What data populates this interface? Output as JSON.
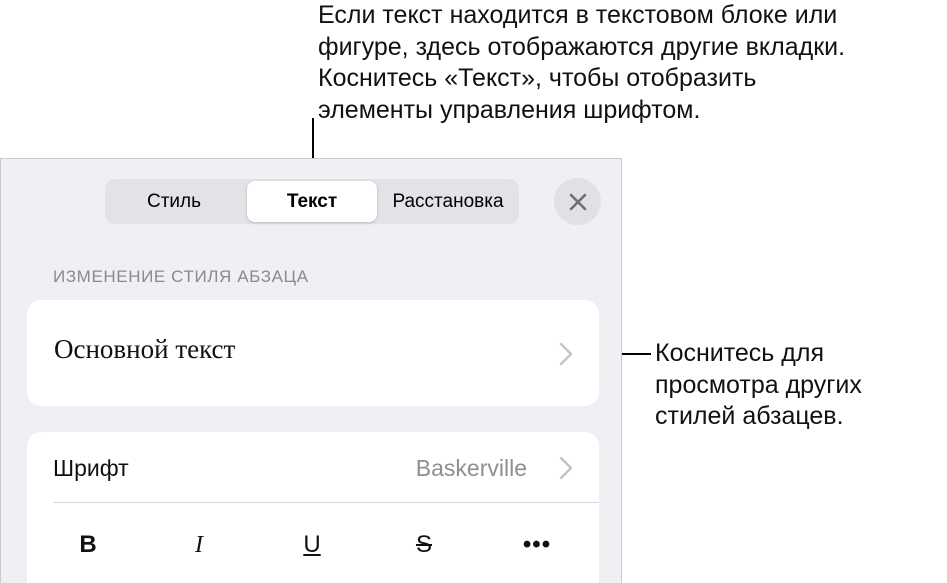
{
  "callouts": {
    "top": [
      "Если текст находится в текстовом блоке или",
      "фигуре, здесь отображаются другие вкладки.",
      "Коснитесь «Текст», чтобы отобразить",
      "элементы управления шрифтом."
    ],
    "right": [
      "Коснитесь для",
      "просмотра других",
      "стилей абзацев."
    ]
  },
  "tabs": {
    "style": "Стиль",
    "text": "Текст",
    "arrange": "Расстановка",
    "selected": "Текст"
  },
  "close_icon": "close-icon",
  "paragraph_style": {
    "header": "ИЗМЕНЕНИЕ СТИЛЯ АБЗАЦА",
    "current": "Основной текст"
  },
  "font": {
    "label": "Шрифт",
    "value": "Baskerville"
  },
  "format_buttons": {
    "bold": "B",
    "italic": "I",
    "underline": "U",
    "strikethrough": "S",
    "more": "•••"
  },
  "colors": {
    "panel_bg": "#efeff4",
    "segment_bg": "#e2e2e7",
    "secondary_text": "#8e8e93"
  }
}
